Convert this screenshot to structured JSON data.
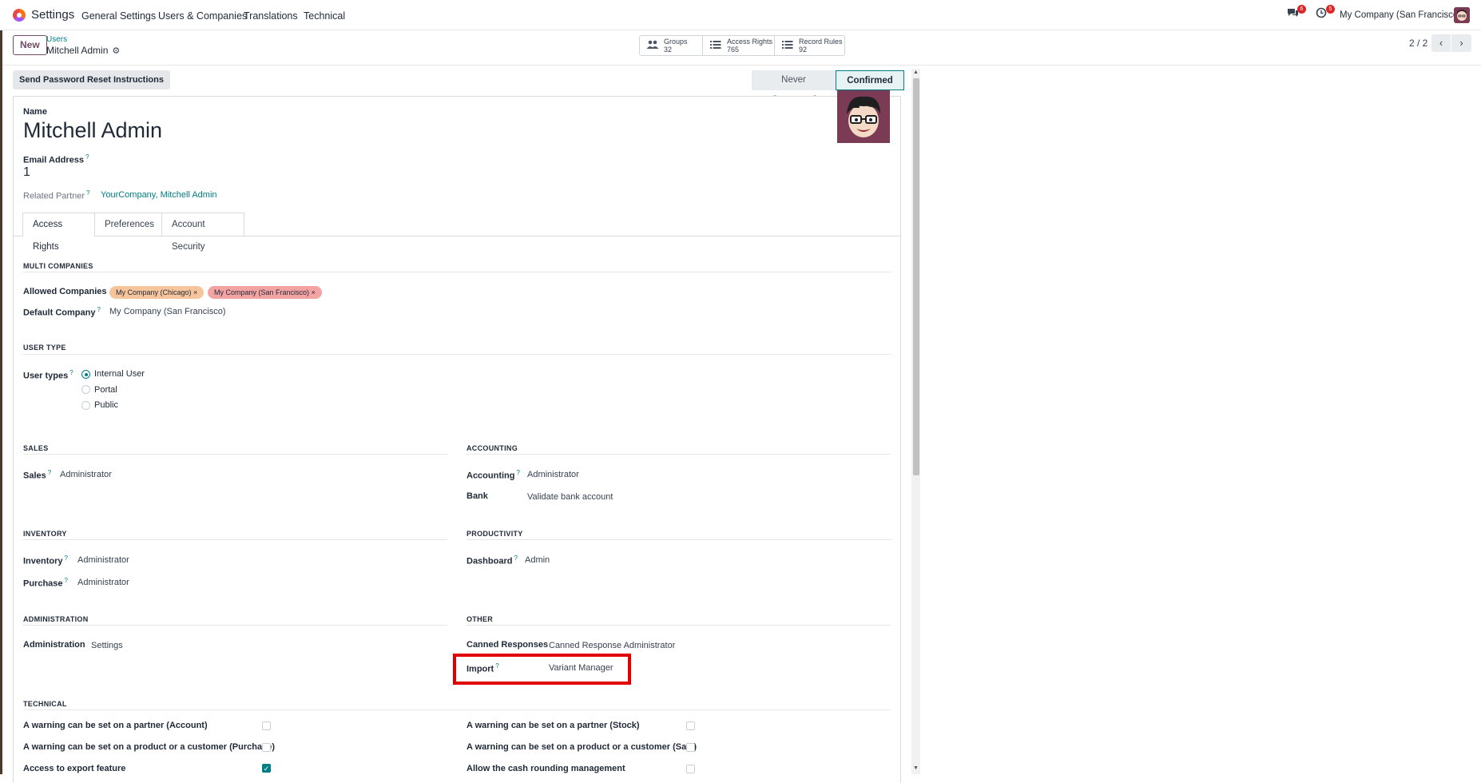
{
  "navbar": {
    "app_name": "Settings",
    "menu": [
      "General Settings",
      "Users & Companies",
      "Translations",
      "Technical"
    ],
    "messages_count": "6",
    "activities_count": "5",
    "company": "My Company (San Francisco)"
  },
  "control_panel": {
    "new_label": "New",
    "breadcrumb_parent": "Users",
    "breadcrumb_current": "Mitchell Admin",
    "stat_buttons": [
      {
        "label": "Groups",
        "value": "32",
        "icon": "users-icon"
      },
      {
        "label": "Access Rights",
        "value": "765",
        "icon": "list-icon"
      },
      {
        "label": "Record Rules",
        "value": "92",
        "icon": "list-icon"
      }
    ],
    "pager": "2 / 2"
  },
  "header": {
    "reset_button": "Send Password Reset Instructions",
    "status": [
      "Never Connected",
      "Confirmed"
    ],
    "active_status": "Confirmed"
  },
  "form": {
    "name_label": "Name",
    "name_value": "Mitchell Admin",
    "email_label": "Email Address",
    "email_value": "1",
    "partner_label": "Related Partner",
    "partner_value": "YourCompany, Mitchell Admin",
    "help_mark": "?"
  },
  "tabs": [
    "Access Rights",
    "Preferences",
    "Account Security"
  ],
  "multi_companies": {
    "title": "MULTI COMPANIES",
    "allowed_label": "Allowed Companies",
    "allowed_tags": [
      {
        "label": "My Company (Chicago)",
        "color": "#f7c59b"
      },
      {
        "label": "My Company (San Francisco)",
        "color": "#f4a3a3"
      }
    ],
    "tag_remove": "×",
    "default_label": "Default Company",
    "default_value": "My Company (San Francisco)"
  },
  "user_type": {
    "title": "USER TYPE",
    "label": "User types",
    "options": [
      "Internal User",
      "Portal",
      "Public"
    ],
    "selected": "Internal User"
  },
  "groups": {
    "sales": {
      "title": "SALES",
      "rows": [
        {
          "label": "Sales",
          "value": "Administrator"
        }
      ]
    },
    "accounting": {
      "title": "ACCOUNTING",
      "rows": [
        {
          "label": "Accounting",
          "value": "Administrator"
        },
        {
          "label": "Bank",
          "value": "Validate bank account"
        }
      ]
    },
    "inventory": {
      "title": "INVENTORY",
      "rows": [
        {
          "label": "Inventory",
          "value": "Administrator"
        },
        {
          "label": "Purchase",
          "value": "Administrator"
        }
      ]
    },
    "productivity": {
      "title": "PRODUCTIVITY",
      "rows": [
        {
          "label": "Dashboard",
          "value": "Admin"
        }
      ]
    },
    "administration": {
      "title": "ADMINISTRATION",
      "rows": [
        {
          "label": "Administration",
          "value": "Settings"
        }
      ]
    },
    "other": {
      "title": "OTHER",
      "rows": [
        {
          "label": "Canned Responses",
          "value": "Canned Response Administrator"
        },
        {
          "label": "Import",
          "value": "Variant Manager"
        }
      ]
    }
  },
  "technical": {
    "title": "TECHNICAL",
    "left": [
      {
        "label": "A warning can be set on a partner (Account)",
        "checked": false
      },
      {
        "label": "A warning can be set on a product or a customer (Purchase)",
        "checked": false
      },
      {
        "label": "Access to export feature",
        "checked": true
      }
    ],
    "right": [
      {
        "label": "A warning can be set on a partner (Stock)",
        "checked": false
      },
      {
        "label": "A warning can be set on a product or a customer (Sale)",
        "checked": false
      },
      {
        "label": "Allow the cash rounding management",
        "checked": false
      }
    ]
  },
  "colors": {
    "brand": "#714b67",
    "accent": "#017e84",
    "highlight": "#e10000"
  }
}
